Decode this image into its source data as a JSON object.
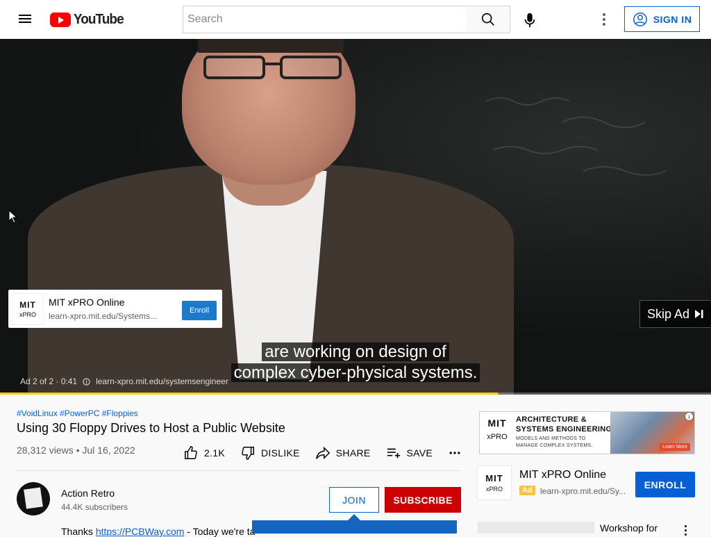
{
  "header": {
    "logo_text": "YouTube",
    "search_placeholder": "Search",
    "signin_label": "SIGN IN"
  },
  "player": {
    "ad_card": {
      "logo_line1": "MIT",
      "logo_line2": "xPRO",
      "title": "MIT xPRO Online",
      "url": "learn-xpro.mit.edu/Systems...",
      "button": "Enroll"
    },
    "skip_label": "Skip Ad",
    "caption_line1": "are working on design of",
    "caption_line2": "complex cyber-physical systems.",
    "ad_counter": "Ad 2 of 2 · 0:41",
    "ad_url": "learn-xpro.mit.edu/systemsengineer",
    "progress_fraction": 0.7,
    "progress_color": "#ffcc00"
  },
  "video": {
    "tags": "#VoidLinux #PowerPC #Floppies",
    "title": "Using 30 Floppy Drives to Host a Public Website",
    "views": "28,312 views • Jul 16, 2022",
    "likes": "2.1K",
    "dislike_label": "DISLIKE",
    "share_label": "SHARE",
    "save_label": "SAVE"
  },
  "channel": {
    "name": "Action Retro",
    "subscribers": "44.4K subscribers",
    "join_label": "JOIN",
    "subscribe_label": "SUBSCRIBE",
    "description_prefix": "Thanks ",
    "description_link": "https://PCBWay.com",
    "description_rest": " - Today we're ta"
  },
  "sidebar": {
    "banner": {
      "logo_line1": "MIT",
      "logo_line2": "xPRO",
      "headline_line1": "ARCHITECTURE &",
      "headline_line2": "SYSTEMS ENGINEERING",
      "sub_line1": "MODELS AND METHODS TO",
      "sub_line2": "MANAGE COMPLEX SYSTEMS.",
      "cta": "Learn More"
    },
    "ad": {
      "logo_line1": "MIT",
      "logo_line2": "xPRO",
      "title": "MIT xPRO Online",
      "badge": "Ad",
      "url": "learn-xpro.mit.edu/Sy...",
      "button": "ENROLL"
    },
    "next_title": "Workshop for"
  },
  "colors": {
    "brand_red": "#ff0000",
    "link_blue": "#065fd4",
    "subscribe_red": "#cc0000",
    "ad_badge": "#f6c343"
  }
}
